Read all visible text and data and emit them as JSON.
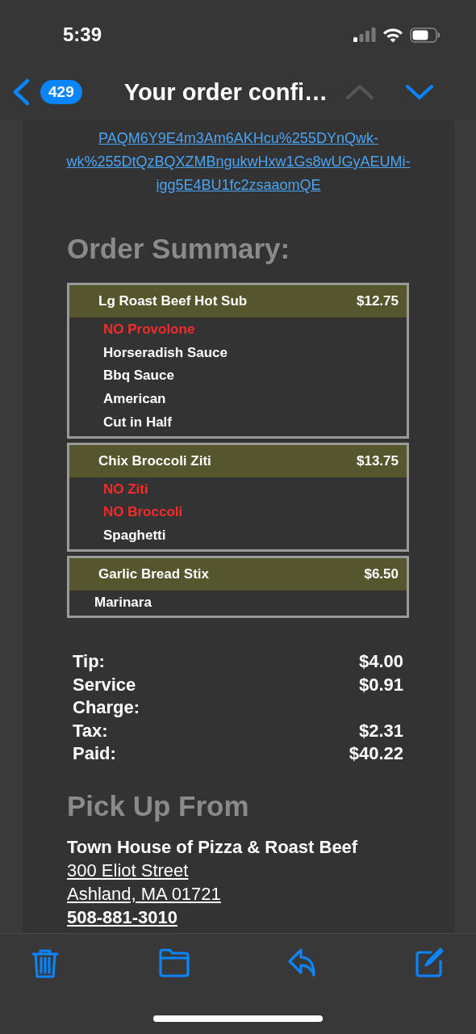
{
  "status_bar": {
    "time": "5:39"
  },
  "nav_bar": {
    "unread_count": "429",
    "title": "Your order confi…",
    "previous_disabled": true,
    "next_disabled": false
  },
  "message": {
    "link_lines": [
      "PAQM6Y9E4m3Am6AKHcu%255DYnQwk-",
      "wk%255DtQzBQXZMBngukwHxw1Gs8wUGyAEUMi-",
      "igg5E4BU1fc2zsaaomQE"
    ],
    "order_summary_heading": "Order Summary:",
    "items": [
      {
        "name": "Lg Roast Beef Hot Sub",
        "price": "$12.75",
        "options": [
          {
            "text": "NO Provolone",
            "kind": "removed"
          },
          {
            "text": "Horseradish Sauce",
            "kind": "added"
          },
          {
            "text": "Bbq Sauce",
            "kind": "added"
          },
          {
            "text": "American",
            "kind": "added"
          },
          {
            "text": "Cut in Half",
            "kind": "added"
          }
        ]
      },
      {
        "name": "Chix Broccoli Ziti",
        "price": "$13.75",
        "options": [
          {
            "text": "NO Ziti",
            "kind": "removed"
          },
          {
            "text": "NO Broccoli",
            "kind": "removed"
          },
          {
            "text": "Spaghetti",
            "kind": "added"
          }
        ]
      },
      {
        "name": "Garlic Bread Stix",
        "price": "$6.50",
        "options": [
          {
            "text": "Marinara",
            "kind": "note"
          }
        ]
      }
    ],
    "totals": [
      {
        "label": "Tip:",
        "value": "$4.00"
      },
      {
        "label": "Service Charge:",
        "value": "$0.91"
      },
      {
        "label": "Tax:",
        "value": "$2.31"
      },
      {
        "label": "Paid:",
        "value": "$40.22"
      }
    ],
    "pickup_heading": "Pick Up From",
    "pickup": {
      "name": "Town House of Pizza & Roast Beef",
      "address_lines": [
        "300 Eliot Street",
        "Ashland, MA 01721"
      ],
      "phone": "508-881-3010"
    }
  }
}
